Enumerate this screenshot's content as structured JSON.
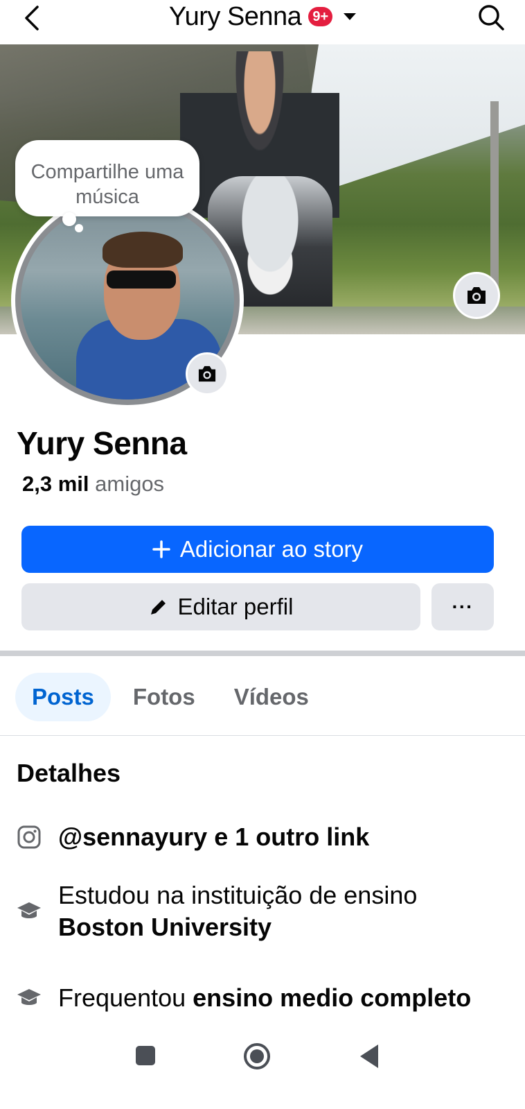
{
  "header": {
    "title": "Yury Senna",
    "notification_badge": "9+",
    "icons": [
      "back-icon",
      "caret-down-icon",
      "search-icon"
    ]
  },
  "cover": {
    "camera_icon": "camera-icon"
  },
  "avatar": {
    "camera_icon": "camera-icon",
    "note_bubble_text": "Compartilhe uma música"
  },
  "profile": {
    "name": "Yury Senna",
    "friends_count": "2,3 mil",
    "friends_label": "amigos"
  },
  "actions": {
    "add_story_label": "Adicionar ao story",
    "edit_profile_label": "Editar perfil",
    "more_label": "···"
  },
  "tabs": [
    {
      "label": "Posts",
      "active": true
    },
    {
      "label": "Fotos",
      "active": false
    },
    {
      "label": "Vídeos",
      "active": false
    }
  ],
  "details": {
    "title": "Detalhes",
    "instagram": {
      "icon": "instagram-icon",
      "text": "@sennayury e 1 outro link"
    },
    "university": {
      "icon": "graduation-cap-icon",
      "prefix": "Estudou na instituição de ensino",
      "name": "Boston University"
    },
    "high_school": {
      "icon": "graduation-cap-icon",
      "prefix": "Frequentou",
      "name": "ensino medio completo"
    }
  },
  "colors": {
    "primary": "#0866ff",
    "secondary_button": "#e4e6eb",
    "badge": "#e41e3f",
    "active_tab_bg": "#ebf5ff",
    "active_tab_text": "#0064d1",
    "muted_text": "#65676b"
  },
  "system_nav": [
    "recents-icon",
    "home-icon",
    "back-icon"
  ]
}
